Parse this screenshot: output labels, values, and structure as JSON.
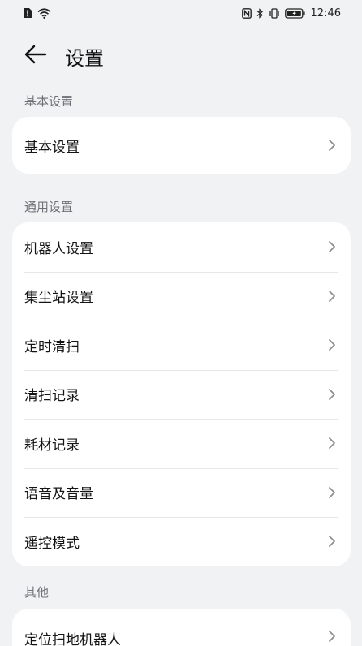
{
  "status": {
    "time": "12:46"
  },
  "header": {
    "title": "设置"
  },
  "sections": [
    {
      "title": "基本设置",
      "items": [
        {
          "label": "基本设置"
        }
      ]
    },
    {
      "title": "通用设置",
      "items": [
        {
          "label": "机器人设置"
        },
        {
          "label": "集尘站设置"
        },
        {
          "label": "定时清扫"
        },
        {
          "label": "清扫记录"
        },
        {
          "label": "耗材记录"
        },
        {
          "label": "语音及音量"
        },
        {
          "label": "遥控模式"
        }
      ]
    },
    {
      "title": "其他",
      "items": [
        {
          "label": "定位扫地机器人"
        }
      ]
    }
  ],
  "colors": {
    "background": "#f1f2f4",
    "card": "#ffffff",
    "section_title": "#6f7176",
    "chevron": "#8c8e93"
  },
  "icons": {
    "back": "arrow-left-icon",
    "row": "chevron-right-icon"
  }
}
